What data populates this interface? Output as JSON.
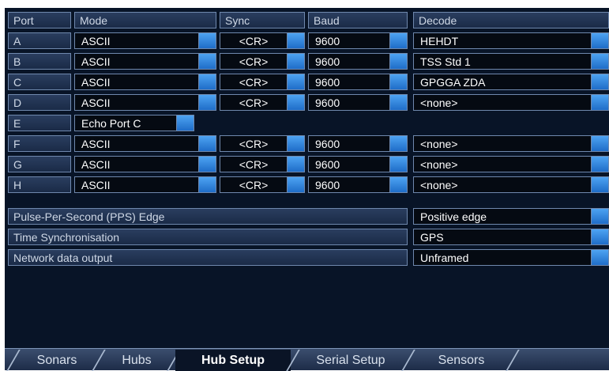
{
  "headers": {
    "port": "Port",
    "mode": "Mode",
    "sync": "Sync",
    "baud": "Baud",
    "decode": "Decode"
  },
  "ports": [
    {
      "port": "A",
      "mode": "ASCII",
      "sync": "<CR>",
      "baud": "9600",
      "decode": "HEHDT"
    },
    {
      "port": "B",
      "mode": "ASCII",
      "sync": "<CR>",
      "baud": "9600",
      "decode": "TSS Std 1"
    },
    {
      "port": "C",
      "mode": "ASCII",
      "sync": "<CR>",
      "baud": "9600",
      "decode": "GPGGA ZDA"
    },
    {
      "port": "D",
      "mode": "ASCII",
      "sync": "<CR>",
      "baud": "9600",
      "decode": "<none>"
    },
    {
      "port": "E",
      "mode": "Echo Port C"
    },
    {
      "port": "F",
      "mode": "ASCII",
      "sync": "<CR>",
      "baud": "9600",
      "decode": "<none>"
    },
    {
      "port": "G",
      "mode": "ASCII",
      "sync": "<CR>",
      "baud": "9600",
      "decode": "<none>"
    },
    {
      "port": "H",
      "mode": "ASCII",
      "sync": "<CR>",
      "baud": "9600",
      "decode": "<none>"
    }
  ],
  "settings": [
    {
      "label": "Pulse-Per-Second (PPS) Edge",
      "value": "Positive edge"
    },
    {
      "label": "Time Synchronisation",
      "value": "GPS"
    },
    {
      "label": "Network data output",
      "value": "Unframed"
    }
  ],
  "tabs": [
    {
      "label": "Sonars"
    },
    {
      "label": "Hubs"
    },
    {
      "label": "Hub Setup",
      "active": true
    },
    {
      "label": "Serial Setup"
    },
    {
      "label": "Sensors"
    }
  ]
}
